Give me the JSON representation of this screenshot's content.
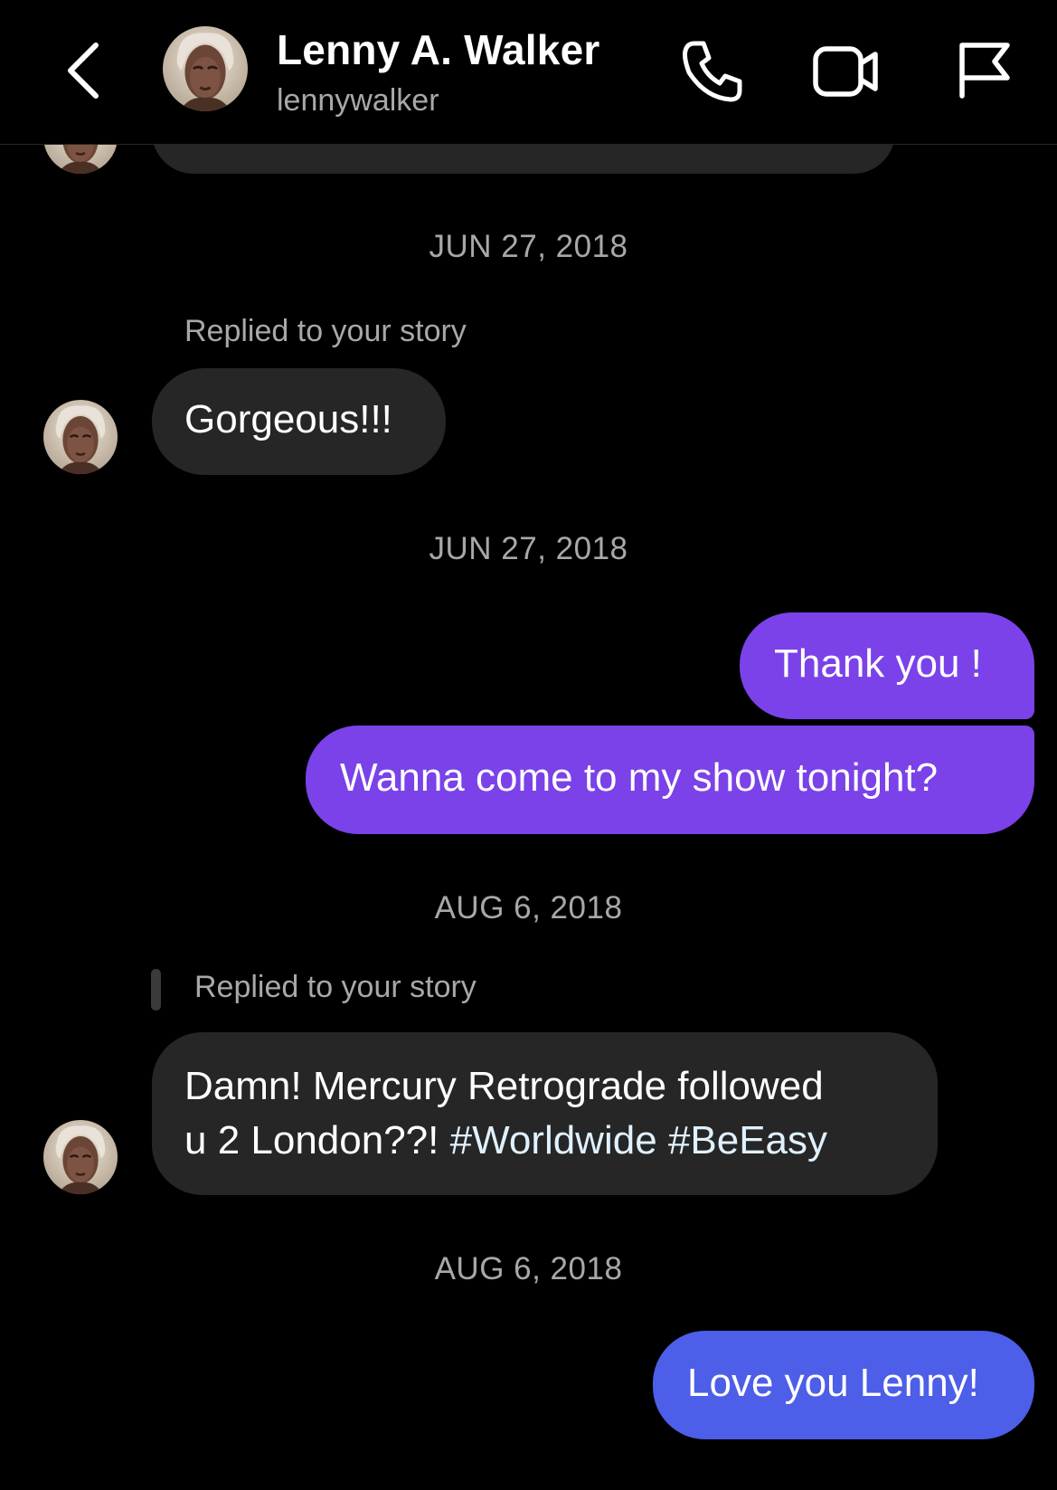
{
  "header": {
    "name": "Lenny A. Walker",
    "username": "lennywalker",
    "icons": {
      "back": "chevron-left-icon",
      "call": "phone-icon",
      "video": "video-camera-icon",
      "report": "flag-icon"
    }
  },
  "messages": {
    "date1": "JUN 27, 2018",
    "reply1_note": "Replied to your story",
    "msg1": "Gorgeous!!!",
    "date2": "JUN 27, 2018",
    "msg2": "Thank you !",
    "msg3": "Wanna come to my show tonight?",
    "date3": "AUG 6, 2018",
    "reply2_note": "Replied to your story",
    "msg4_line1": "Damn! Mercury Retrograde followed",
    "msg4_line2_prefix": "u 2 London??! ",
    "msg4_hashtag1": "#Worldwide",
    "msg4_hashtag2": "#BeEasy",
    "date4": "AUG 6, 2018",
    "msg5": "Love you Lenny!"
  },
  "colors": {
    "background": "#000000",
    "incoming_bubble": "#262626",
    "outgoing_purple": "#7a42e8",
    "outgoing_blue": "#4d5ee8",
    "muted_text": "#a8a8a8",
    "hashtag": "#e0f1ff"
  }
}
